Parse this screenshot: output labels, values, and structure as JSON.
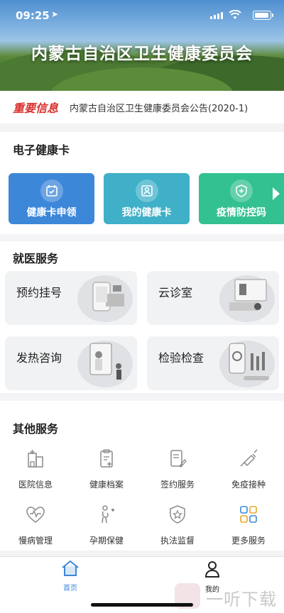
{
  "status_bar": {
    "time": "09:25"
  },
  "header": {
    "title": "内蒙古自治区卫生健康委员会"
  },
  "notice": {
    "badge": "重要信息",
    "text": "内蒙古自治区卫生健康委员会公告(2020-1)"
  },
  "health_card": {
    "title": "电子健康卡",
    "buttons": [
      {
        "label": "健康卡申领",
        "color": "#3d87d9"
      },
      {
        "label": "我的健康卡",
        "color": "#3fb0c8"
      },
      {
        "label": "疫情防控码",
        "color": "#33c191"
      }
    ]
  },
  "medical": {
    "title": "就医服务",
    "items": [
      {
        "label": "预约挂号"
      },
      {
        "label": "云诊室"
      },
      {
        "label": "发热咨询"
      },
      {
        "label": "检验检查"
      }
    ]
  },
  "other": {
    "title": "其他服务",
    "items": [
      {
        "label": "医院信息",
        "icon": "hospital-icon"
      },
      {
        "label": "健康档案",
        "icon": "clipboard-plus-icon"
      },
      {
        "label": "签约服务",
        "icon": "document-pen-icon"
      },
      {
        "label": "免疫接种",
        "icon": "syringe-icon"
      },
      {
        "label": "慢病管理",
        "icon": "heart-pulse-icon"
      },
      {
        "label": "孕期保健",
        "icon": "pregnant-icon"
      },
      {
        "label": "执法监督",
        "icon": "badge-star-icon"
      },
      {
        "label": "更多服务",
        "icon": "grid-icon"
      }
    ]
  },
  "tabbar": {
    "home": "首页",
    "mine": "我的"
  },
  "watermark": {
    "text": "一听下载"
  },
  "colors": {
    "accent": "#3d87d9",
    "notice_badge": "#d9322e",
    "other_icons": "#8a8a8a",
    "more_services_icon": "#3d87d9"
  }
}
